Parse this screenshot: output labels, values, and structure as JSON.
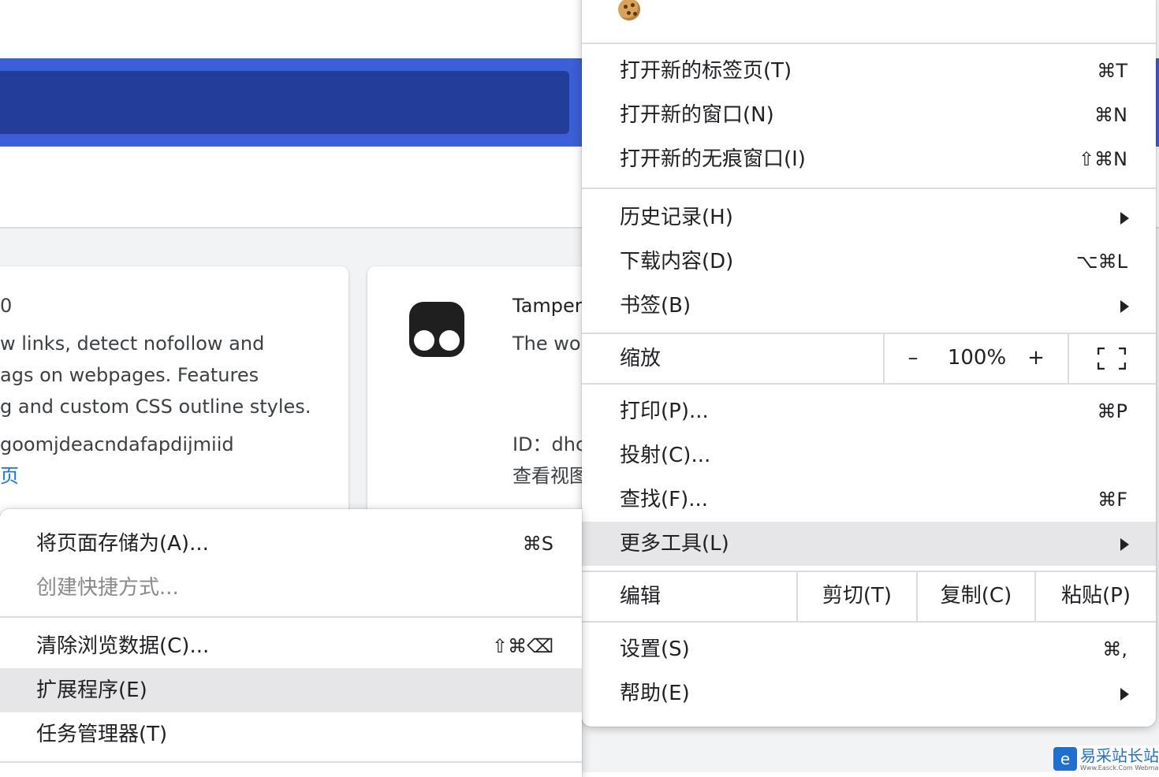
{
  "page": {
    "card_a": {
      "title_fragment": "0",
      "desc_lines": [
        "w links, detect nofollow and",
        "ags on webpages. Features",
        "g and custom CSS outline styles."
      ],
      "id_fragment": "goomjdeacndafapdijmiid",
      "link_fragment": "页"
    },
    "card_b": {
      "title_fragment": "Tamper",
      "desc_fragment": "The wor",
      "id_fragment": "ID：dhc",
      "link_fragment": "查看视图"
    }
  },
  "main_menu": {
    "cookie_icon": "cookie-icon",
    "items": [
      {
        "label": "打开新的标签页(T)",
        "shortcut": "⌘T"
      },
      {
        "label": "打开新的窗口(N)",
        "shortcut": "⌘N"
      },
      {
        "label": "打开新的无痕窗口(I)",
        "shortcut": "⇧⌘N"
      },
      {
        "label": "历史记录(H)",
        "shortcut": ""
      },
      {
        "label": "下载内容(D)",
        "shortcut": "⌥⌘L"
      },
      {
        "label": "书签(B)",
        "shortcut": ""
      },
      {
        "label": "打印(P)...",
        "shortcut": "⌘P"
      },
      {
        "label": "投射(C)...",
        "shortcut": ""
      },
      {
        "label": "查找(F)...",
        "shortcut": "⌘F"
      },
      {
        "label": "更多工具(L)",
        "shortcut": ""
      },
      {
        "label": "设置(S)",
        "shortcut": "⌘,"
      },
      {
        "label": "帮助(E)",
        "shortcut": ""
      }
    ],
    "zoom": {
      "label": "缩放",
      "minus": "–",
      "value": "100%",
      "plus": "+"
    },
    "edit": {
      "label": "编辑",
      "cut": "剪切(T)",
      "copy": "复制(C)",
      "paste": "粘贴(P)"
    }
  },
  "sub_menu": {
    "items": [
      {
        "label": "将页面存储为(A)...",
        "shortcut": "⌘S"
      },
      {
        "label": "创建快捷方式...",
        "shortcut": ""
      },
      {
        "label": "清除浏览数据(C)...",
        "shortcut": "⇧⌘⌫"
      },
      {
        "label": "扩展程序(E)",
        "shortcut": ""
      },
      {
        "label": "任务管理器(T)",
        "shortcut": ""
      }
    ]
  },
  "watermark": {
    "text": "易采站长站",
    "sub": "Www.Easck.Com Webmaster"
  }
}
